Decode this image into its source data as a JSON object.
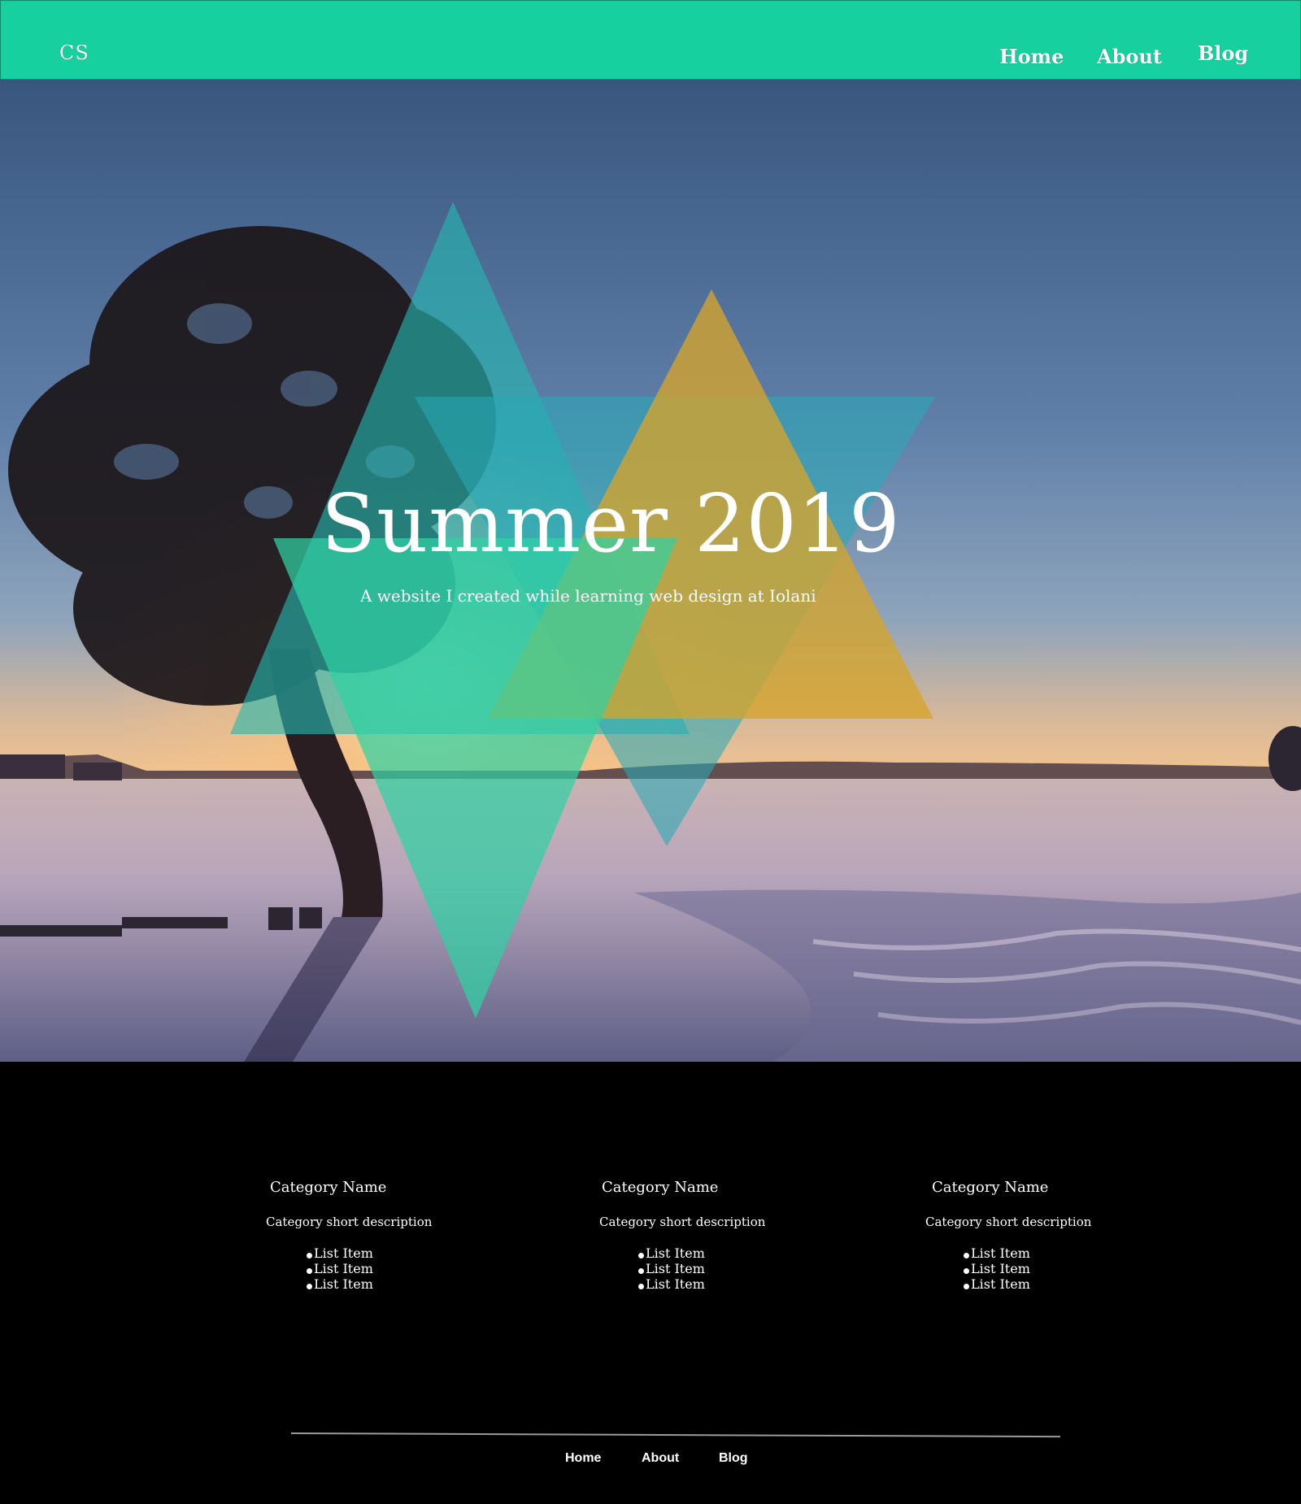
{
  "header": {
    "logo": "CS",
    "nav": [
      "Home",
      "About",
      "Blog"
    ],
    "background_color": "#16d19f"
  },
  "hero": {
    "title": "Summer 2019",
    "subtitle": "A website I created while learning web design at Iolani",
    "overlay_colors": [
      "#25b8b0",
      "#d6a42a",
      "#2fd1a3"
    ]
  },
  "categories": [
    {
      "title": "Category Name",
      "description": "Category short description",
      "items": [
        "List Item",
        "List Item",
        "List Item"
      ]
    },
    {
      "title": "Category Name",
      "description": "Category short description",
      "items": [
        "List Item",
        "List Item",
        "List Item"
      ]
    },
    {
      "title": "Category Name",
      "description": "Category short description",
      "items": [
        "List Item",
        "List Item",
        "List Item"
      ]
    }
  ],
  "footer": {
    "nav": [
      "Home",
      "About",
      "Blog"
    ]
  }
}
